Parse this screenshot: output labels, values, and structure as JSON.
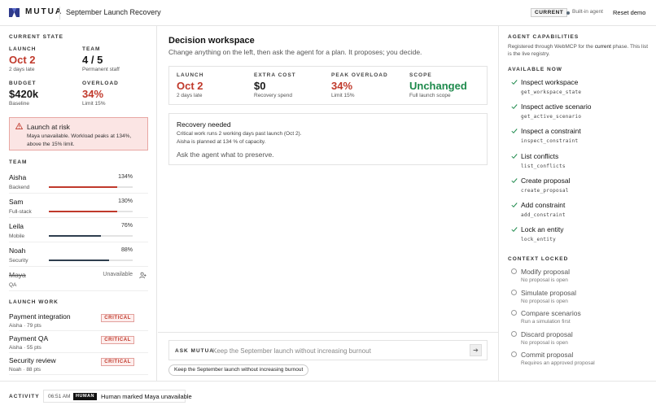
{
  "header": {
    "brand": "MUTUA",
    "title": "September Launch Recovery",
    "badge": "CURRENT",
    "agent_label": "Built-in agent",
    "reset_label": "Reset demo"
  },
  "current_state": {
    "label": "CURRENT STATE",
    "stats": [
      {
        "label": "LAUNCH",
        "value": "Oct 2",
        "sub": "2 days late"
      },
      {
        "label": "TEAM",
        "value": "4 / 5",
        "sub": "Permanent staff"
      },
      {
        "label": "BUDGET",
        "value": "$420k",
        "sub": "Baseline"
      },
      {
        "label": "OVERLOAD",
        "value": "34%",
        "sub": "Limit 15%"
      }
    ],
    "risk": {
      "title": "Launch at risk",
      "text": "Maya unavailable. Workload peaks at 134%, above the 15% limit."
    }
  },
  "team": {
    "label": "TEAM",
    "members": [
      {
        "name": "Aisha",
        "role": "Backend",
        "pct": "134%",
        "load": 1.34
      },
      {
        "name": "Sam",
        "role": "Full-stack",
        "pct": "130%",
        "load": 1.3
      },
      {
        "name": "Leila",
        "role": "Mobile",
        "pct": "76%",
        "load": 0.76
      },
      {
        "name": "Noah",
        "role": "Security",
        "pct": "88%",
        "load": 0.88
      },
      {
        "name": "Maya",
        "role": "QA",
        "status": "Unavailable"
      }
    ]
  },
  "launch_work": {
    "label": "LAUNCH WORK",
    "items": [
      {
        "name": "Payment integration",
        "meta": "Aisha · 79 pts",
        "badge": "CRITICAL"
      },
      {
        "name": "Payment QA",
        "meta": "Aisha · 55 pts",
        "badge": "CRITICAL"
      },
      {
        "name": "Security review",
        "meta": "Noah · 88 pts",
        "badge": "CRITICAL"
      }
    ]
  },
  "workspace": {
    "title": "Decision workspace",
    "subtitle": "Change anything on the left, then ask the agent for a plan. It proposes; you decide.",
    "metrics": [
      {
        "label": "LAUNCH",
        "value": "Oct 2",
        "sub": "2 days late"
      },
      {
        "label": "EXTRA COST",
        "value": "$0",
        "sub": "Recovery spend"
      },
      {
        "label": "PEAK OVERLOAD",
        "value": "34%",
        "sub": "Limit 15%"
      },
      {
        "label": "SCOPE",
        "value": "Unchanged",
        "sub": "Full launch scope"
      }
    ],
    "recovery": {
      "title": "Recovery needed",
      "line1": "Critical work runs 2 working days past launch (Oct 2).",
      "line2": "Aisha is planned at 134 % of capacity.",
      "ask": "Ask the agent what to preserve."
    },
    "ask": {
      "label": "ASK MUTUA",
      "placeholder": "Keep the September launch without increasing burnout",
      "send_icon": "arrow-right-icon",
      "suggestion": "Keep the September launch without increasing burnout"
    }
  },
  "capabilities": {
    "label": "AGENT CAPABILITIES",
    "desc_prefix": "Registered through WebMCP for the",
    "desc_phase": "current",
    "desc_suffix": "phase. This list is the live registry.",
    "available_label": "AVAILABLE NOW",
    "available": [
      {
        "name": "Inspect workspace",
        "code": "get_workspace_state"
      },
      {
        "name": "Inspect active scenario",
        "code": "get_active_scenario"
      },
      {
        "name": "Inspect a constraint",
        "code": "inspect_constraint"
      },
      {
        "name": "List conflicts",
        "code": "list_conflicts"
      },
      {
        "name": "Create proposal",
        "code": "create_proposal"
      },
      {
        "name": "Add constraint",
        "code": "add_constraint"
      },
      {
        "name": "Lock an entity",
        "code": "lock_entity"
      }
    ],
    "locked_label": "CONTEXT LOCKED",
    "locked": [
      {
        "name": "Modify proposal",
        "why": "No proposal is open"
      },
      {
        "name": "Simulate proposal",
        "why": "No proposal is open"
      },
      {
        "name": "Compare scenarios",
        "why": "Run a simulation first"
      },
      {
        "name": "Discard proposal",
        "why": "No proposal is open"
      },
      {
        "name": "Commit proposal",
        "why": "Requires an approved proposal"
      }
    ]
  },
  "activity": {
    "label": "ACTIVITY",
    "time": "06:51 AM",
    "badge": "HUMAN",
    "text": "Human marked Maya unavailable"
  },
  "colors": {
    "critical": "#c0392b",
    "success": "#1e8a4c",
    "bar_over": "#c0392b",
    "bar_normal": "#2f3e4e",
    "brand": "#2e3a8c"
  }
}
